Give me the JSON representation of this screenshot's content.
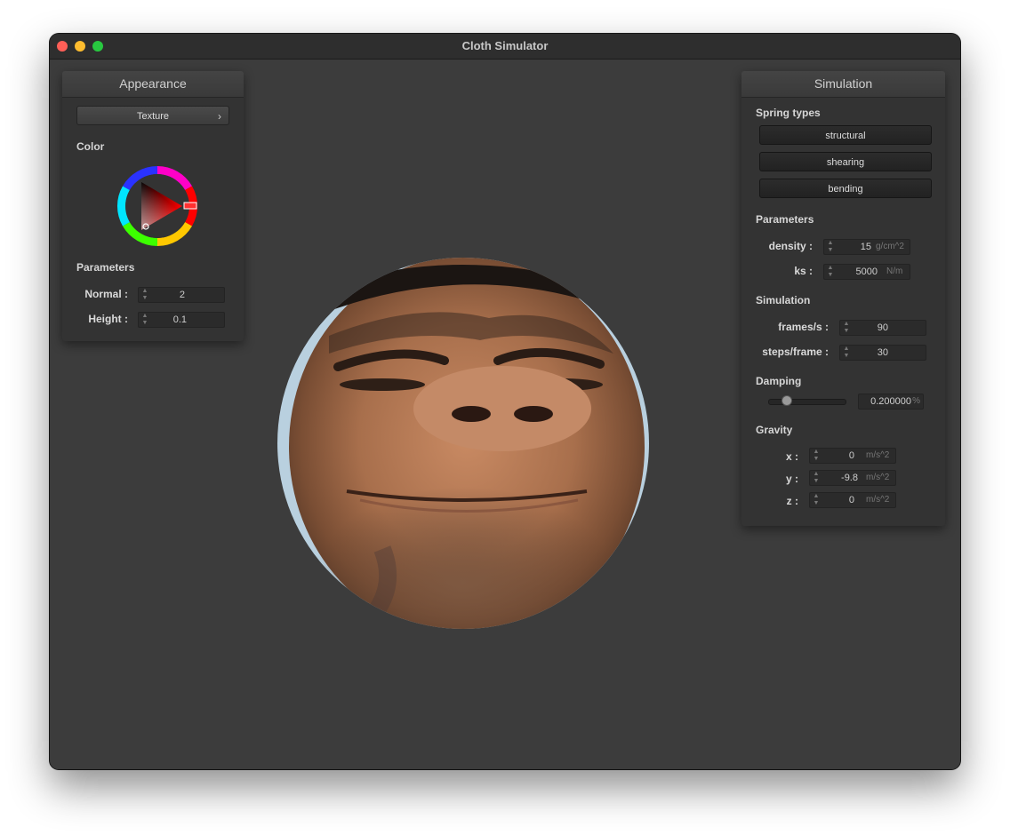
{
  "window": {
    "title": "Cloth Simulator"
  },
  "appearance": {
    "header": "Appearance",
    "texture_button": "Texture",
    "color_label": "Color",
    "parameters_label": "Parameters",
    "normal": {
      "label": "Normal :",
      "value": "2"
    },
    "height": {
      "label": "Height :",
      "value": "0.1"
    },
    "color_wheel": {
      "selected_hue_color": "#ff0000"
    }
  },
  "simulation": {
    "header": "Simulation",
    "spring_types_label": "Spring types",
    "spring_types": [
      "structural",
      "shearing",
      "bending"
    ],
    "parameters_label": "Parameters",
    "density": {
      "label": "density :",
      "value": "15",
      "unit": "g/cm^2"
    },
    "ks": {
      "label": "ks :",
      "value": "5000",
      "unit": "N/m"
    },
    "simulation_label": "Simulation",
    "frames_per_s": {
      "label": "frames/s :",
      "value": "90"
    },
    "steps_per_frame": {
      "label": "steps/frame :",
      "value": "30"
    },
    "damping_label": "Damping",
    "damping": {
      "value": "0.200000",
      "unit": "%",
      "slider_fraction": 0.2
    },
    "gravity_label": "Gravity",
    "gravity": {
      "x": {
        "label": "x :",
        "value": "0",
        "unit": "m/s^2"
      },
      "y": {
        "label": "y :",
        "value": "-9.8",
        "unit": "m/s^2"
      },
      "z": {
        "label": "z :",
        "value": "0",
        "unit": "m/s^2"
      }
    }
  },
  "scene": {
    "object": "textured cloth sphere with face image"
  }
}
